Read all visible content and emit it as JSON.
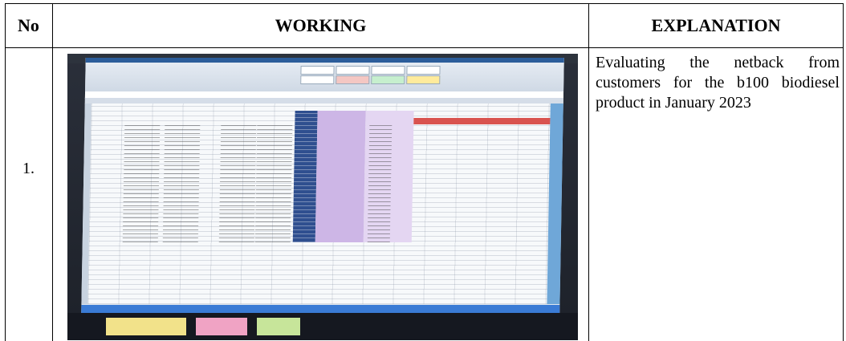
{
  "table": {
    "headers": {
      "no": "No",
      "working": "WORKING",
      "explanation": "EXPLANATION"
    },
    "rows": [
      {
        "number": "1.",
        "explanation": "Evaluating the netback from customers for the b100 biodiesel product in January 2023",
        "photo_icon": "spreadsheet-photo"
      }
    ]
  }
}
